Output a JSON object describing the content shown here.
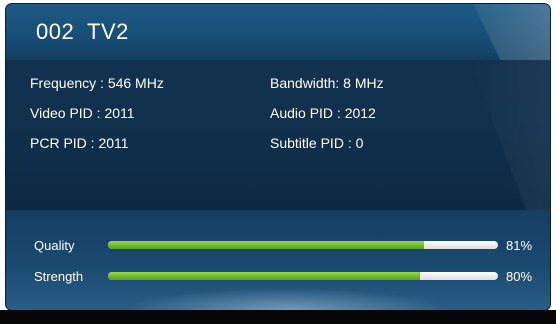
{
  "channel": {
    "number": "002",
    "name": "TV2"
  },
  "info": {
    "frequency": "Frequency : 546 MHz",
    "bandwidth": "Bandwidth: 8 MHz",
    "video_pid": "Video PID : 2011",
    "audio_pid": "Audio PID : 2012",
    "pcr_pid": "PCR PID : 2011",
    "subtitle_pid": "Subtitle PID : 0"
  },
  "signal": {
    "quality": {
      "label": "Quality",
      "percent_text": "81%",
      "level": 0.81
    },
    "strength": {
      "label": "Strength",
      "percent_text": "80%",
      "level": 0.8
    }
  },
  "colors": {
    "bar_fill": "#6cb82a",
    "bar_track": "#ffffff",
    "panel_bg": "#0e2a45",
    "header_bg": "#1e5a86"
  }
}
